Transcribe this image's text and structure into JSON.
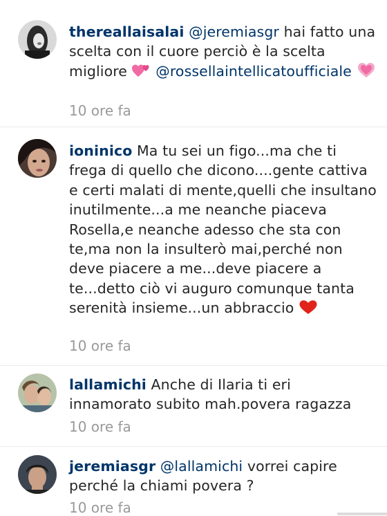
{
  "comments": [
    {
      "username": "thereallaisalai",
      "mention": "@jeremiasgr",
      "text_a": " hai fatto una scelta con il cuore perciò è la scelta migliore ",
      "mention2": "@rossellaintellicatoufficiale",
      "time": "10 ore fa",
      "icons": [
        "two-hearts-icon",
        "sparkling-heart-icon"
      ]
    },
    {
      "username": "ioninico",
      "text": "Ma tu sei un figo...ma che ti frega di quello che dicono....gente cattiva e certi malati di mente,quelli che insultano inutilmente...a me neanche piaceva Rosella,e neanche adesso che sta con te,ma non la insulterò mai,perché non deve piacere a me...deve piacere a te...detto ciò vi auguro comunque tanta serenità insieme...un abbraccio ",
      "time": "10 ore fa",
      "icons": [
        "red-heart-icon"
      ]
    },
    {
      "username": "lallamichi",
      "text": "Anche di Ilaria ti eri innamorato subito mah.povera ragazza",
      "time": "10 ore fa"
    },
    {
      "username": "jeremiasgr",
      "mention": "@lallamichi",
      "text": " vorrei capire perché la chiami povera ?",
      "time": "10 ore fa"
    }
  ],
  "colors": {
    "username": "#003569",
    "time": "#999999",
    "heart_red": "#e0241b",
    "heart_pink": "#f06aa3"
  }
}
